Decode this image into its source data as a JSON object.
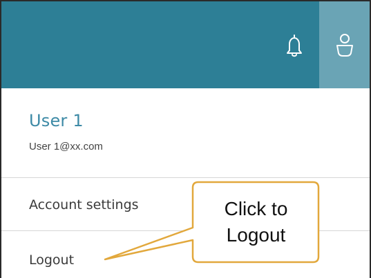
{
  "header": {
    "notifications_icon": "bell-icon",
    "user_icon": "user-icon",
    "bar_color": "#2d7f96",
    "active_button_color": "#6aa4b5"
  },
  "user": {
    "name": "User 1",
    "email": "User 1@xx.com",
    "name_color": "#3d8aa6"
  },
  "menu": {
    "items": [
      {
        "label": "Account settings"
      },
      {
        "label": "Logout"
      }
    ]
  },
  "callout": {
    "line1": "Click to",
    "line2": "Logout",
    "border_color": "#e2a83c"
  }
}
